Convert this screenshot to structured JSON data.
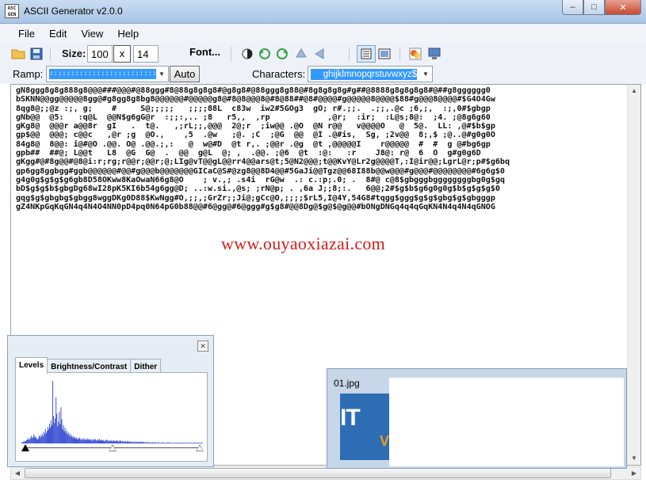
{
  "window": {
    "app_icon_text": "ASC GEN",
    "title": "ASCII Generator v2.0.0",
    "buttons": [
      "minimize",
      "maximize",
      "close"
    ]
  },
  "menu": [
    "File",
    "Edit",
    "View",
    "Help"
  ],
  "toolbar": {
    "size_label": "Size:",
    "width": "100",
    "x_label": "x",
    "height": "14",
    "font_label": "Font..."
  },
  "ramp": {
    "label": "Ramp:",
    "value": "::::::::::::::::::::::::::::::::::::::::",
    "auto_label": "Auto",
    "characters_label": "Characters:",
    "characters_value": "ghijklmnopqrstuvwxyz$"
  },
  "output": {
    "lines": [
      "gN8ggg8g8g888g8@@@###@@@#@88ggg#8@88g8g8g8#@g8g8#@88ggg8g88@#8g8g8g8g#g##@8888g8g8g8g8#@##g8gggggg0",
      "bSKNN@@gg@@@@@8gg@#g8gg8g8bg8@@@@@@#@@@@@g8@#8@8@@@8@#8@88##@8#@@@@#g@@@@@8@@@@$88#g@@@8@@@@#$G4O4Gw",
      "8qg8@;;@z :;, g;    #     S@;;;;;   ;;;;88L  c83w  iw2#5GOg3  gO; r#.;;.  .;;,.@c ;6,;,  :;,0#$gbgp",
      "gNb@@  @5:   :q@L  @@N$g6gG@r  :;;:,.. ;8   r5,,  ,rp            ,@r;  :ir;  :L@s;8@:  ;4. ;@8g6g60",
      "gKg8@  @@@r a@@8r  gI   .  t@.   ,;rL;;,@@@  2@;r  ;iw@@ .@O  @N r@@   v@@@@O   @  5@.  LL: ,@#$b$gp",
      "gp$@@  @@@; c@@c   ,@r ;g  @O.,    ,5  .@w   ;@. ;C  ;@G  @@  @I .@#is,  Sg, ;2v@@  8;,$ ;@..@#g0g0O",
      "84g8@  8@@: i@#@O .@@. O@ .@@.;,:   @  w@#D  @t r,. ;@@r .@g  @t ,@@@@@I    r@@@@@  #  #  g @#bg6gp",
      "gpb##  ##@; L@@t   L8  @G  G@  .  @@  g@L  @; ,  .@@. ;@6  @t  :@:   :r    J8@: r@  6  O  g#g0g6D",
      "gKgg#@#8g@@#@8@i:r;rg;r@@r;@@r;@;LIg@vT@@gL@@rr4@@ars@t;5@N2@@@;t@@KvY@Lr2g@@@@T,:I@ir@@;LgrL@r;p#$g6bq",
      "gp6gg8ggbgg#ggb@@@@@@#@@#g@@@b@@@@@@@GICaC@S#@zg8@@8D4@@#5GaJi@@Tgz@@68I88b@@w@@@#g@@@#@@@@@@@@#6g6g$0",
      "g4g0g$g$g$g6gb8D58OKww8KaOwaN66g8@O    ; v.,; .s4i  rG@w  .: c.:p;.0; .  8#@ c@8$gbgggbggggggggbg0g$gq",
      "bD$g$g$b$gbgDg68wI28pK5KI6b54g6gg@D; ..:w.si.,@s; ;rN@p; . ,6a J;;8;:.   6@@;2#$g$b$g6g0g0g$b$g$g$g$0",
      "gqg$g$gbgbg$gbgg8wggDKg0D88$KwNgg#O,;;,;GrZr;;Ji@;gCc@O,;;;;$rL5,I@4Y,54G8#tqgg$ggg$g$g$gbg$g$gbgggp",
      "gZ4NKpGqKqGN4q4N4O4NN0pD4pq0N64pG0b88@@#6@gg@#6@ggg#g$g8#@@8Dg@$g@$@g@@#bONgDNGq4q4qGqKN4N4q4N4qGNOG"
    ],
    "watermark": "www.ouyaoxiazai.com"
  },
  "levels_panel": {
    "tabs": [
      "Levels",
      "Brightness/Contrast",
      "Dither"
    ],
    "active_tab": "Levels",
    "histogram": [
      2,
      1,
      3,
      2,
      4,
      3,
      5,
      6,
      8,
      5,
      7,
      9,
      12,
      8,
      10,
      14,
      9,
      11,
      8,
      6,
      7,
      10,
      13,
      9,
      12,
      15,
      11,
      18,
      14,
      22,
      16,
      19,
      25,
      21,
      30,
      24,
      35,
      28,
      95,
      42,
      31,
      38,
      70,
      45,
      26,
      33,
      48,
      29,
      55,
      37,
      22,
      28,
      19,
      24,
      16,
      20,
      14,
      17,
      12,
      15,
      10,
      13,
      9,
      11,
      8,
      10,
      7,
      9,
      6,
      8,
      7,
      9,
      6,
      7,
      5,
      8,
      6,
      7,
      5,
      6,
      8,
      5,
      7,
      6,
      5,
      7,
      4,
      6,
      5,
      7,
      6,
      5,
      4,
      6,
      5,
      7,
      4,
      5,
      6,
      4,
      5,
      3,
      5,
      4,
      6,
      4,
      5,
      3,
      4,
      5,
      4,
      3,
      5,
      4,
      3,
      4,
      5,
      3,
      4,
      3,
      5,
      4,
      3,
      4,
      3,
      2,
      4,
      3,
      2,
      3,
      4,
      2,
      3,
      2,
      3,
      2,
      2,
      3,
      2,
      2,
      3,
      2,
      2,
      2,
      3,
      2,
      2,
      3,
      2,
      2,
      2,
      1,
      2,
      2,
      1,
      2,
      1,
      2,
      1,
      1,
      2,
      1,
      1,
      2,
      1,
      1,
      1,
      2,
      1,
      1,
      1,
      1,
      2,
      1,
      1,
      1,
      1,
      1,
      1,
      2,
      1,
      1,
      1,
      1,
      1,
      1,
      1,
      1,
      1,
      1,
      1,
      1,
      1,
      1,
      1,
      1,
      1,
      1,
      1,
      1,
      1,
      1,
      1,
      1,
      1,
      1,
      1,
      1,
      1,
      1,
      1,
      1,
      1,
      1,
      1,
      1,
      1,
      1,
      1,
      1,
      1,
      1
    ],
    "black_point": 0,
    "gamma_point": 0.5,
    "white_point": 1
  },
  "preview": {
    "filename": "01.jpg",
    "image_text": "IT",
    "image_sub": "V"
  },
  "colors": {
    "watermark": "#d41a1a",
    "selection": "#3399ff",
    "histogram": "#1a33cc"
  }
}
